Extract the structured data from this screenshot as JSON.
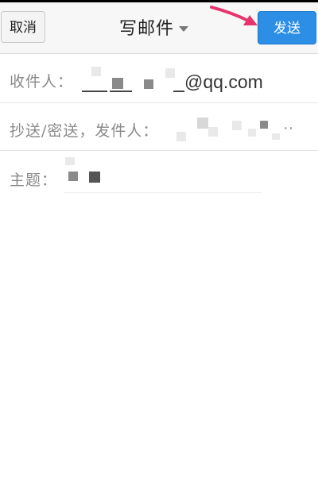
{
  "header": {
    "cancel_label": "取消",
    "title": "写邮件",
    "send_label": "发送"
  },
  "compose": {
    "to_label": "收件人：",
    "to_value_suffix": "@qq.com",
    "cc_label": "抄送/密送，发件人：",
    "cc_more": "··",
    "subject_label": "主题："
  },
  "colors": {
    "send_button_bg": "#2d8ee6",
    "annotation_arrow": "#e8336d"
  }
}
